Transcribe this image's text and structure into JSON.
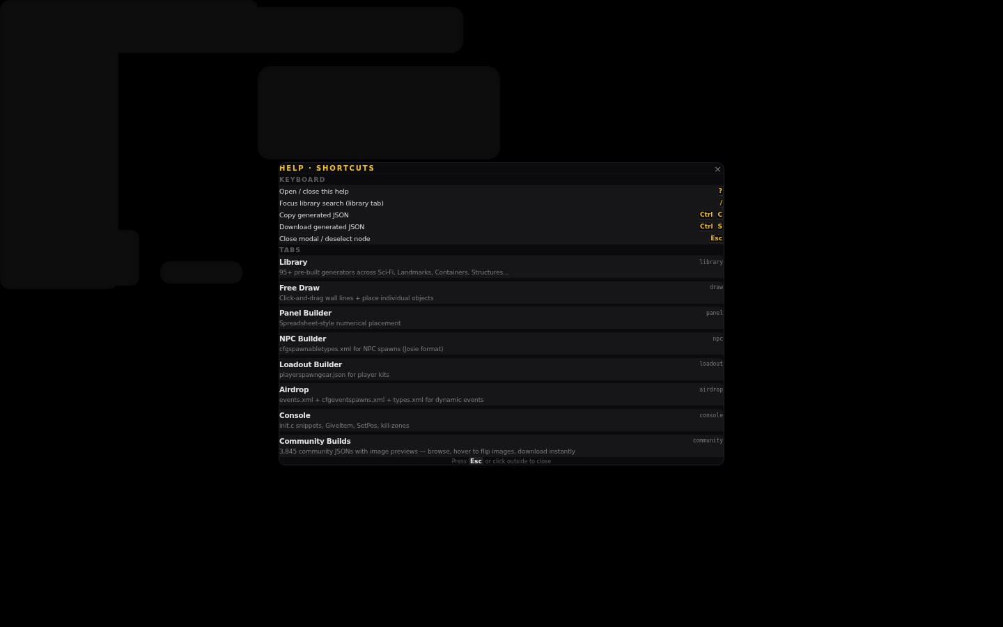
{
  "dialog": {
    "title": "HELP · SHORTCUTS",
    "close_label": "×"
  },
  "sections": [
    {
      "kind": "shortcuts",
      "heading": "KEYBOARD",
      "rows": [
        {
          "action": "Open / close this help",
          "keys": [
            "?"
          ]
        },
        {
          "action": "Focus library search (library tab)",
          "keys": [
            "/"
          ]
        },
        {
          "action": "Copy generated JSON",
          "keys": [
            "Ctrl",
            "C"
          ]
        },
        {
          "action": "Download generated JSON",
          "keys": [
            "Ctrl",
            "S"
          ]
        },
        {
          "action": "Close modal / deselect node",
          "keys": [
            "Esc"
          ]
        }
      ]
    },
    {
      "kind": "tabs",
      "heading": "TABS",
      "items": [
        {
          "title": "Library",
          "description": "95+ pre-built generators across Sci-Fi, Landmarks, Containers, Structures...",
          "tag": "library"
        },
        {
          "title": "Free Draw",
          "description": "Click-and-drag wall lines + place individual objects",
          "tag": "draw"
        },
        {
          "title": "Panel Builder",
          "description": "Spreadsheet-style numerical placement",
          "tag": "panel"
        },
        {
          "title": "NPC Builder",
          "description": "cfgspawnabletypes.xml for NPC spawns (Josie format)",
          "tag": "npc"
        },
        {
          "title": "Loadout Builder",
          "description": "playerspawngear.json for player kits",
          "tag": "loadout"
        },
        {
          "title": "Airdrop",
          "description": "events.xml + cfgeventspawns.xml + types.xml for dynamic events",
          "tag": "airdrop"
        },
        {
          "title": "Console",
          "description": "init.c snippets, GiveItem, SetPos, kill-zones",
          "tag": "console"
        },
        {
          "title": "Community Builds",
          "description": "3,845 community JSONs with image previews — browse, hover to flip images, download instantly",
          "tag": "community"
        }
      ]
    }
  ],
  "footer": {
    "prefix": "Press",
    "key": "Esc",
    "suffix": "or click outside to close"
  }
}
